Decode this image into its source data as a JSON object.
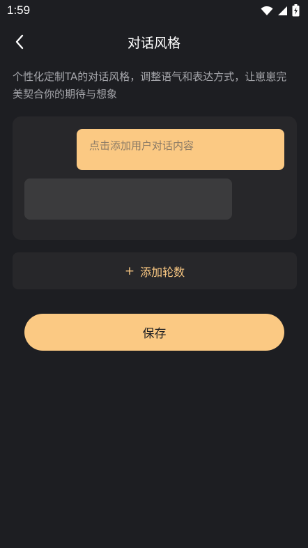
{
  "status_bar": {
    "time": "1:59",
    "icons": [
      "wifi-icon",
      "signal-icon",
      "battery-charging-icon"
    ]
  },
  "nav": {
    "back_icon": "chevron-left-icon",
    "title": "对话风格"
  },
  "description": "个性化定制TA的对话风格，调整语气和表达方式，让崽崽完美契合你的期待与想象",
  "dialog": {
    "user_placeholder": "点击添加用户对话内容",
    "ai_text": ""
  },
  "add_round": {
    "plus": "+",
    "label": "添加轮数"
  },
  "save": {
    "label": "保存"
  },
  "colors": {
    "background": "#1d1e22",
    "card": "#27272a",
    "accent": "#fbc983",
    "ai_bubble": "#3b3b3d",
    "secondary_text": "#a5a6ab"
  }
}
